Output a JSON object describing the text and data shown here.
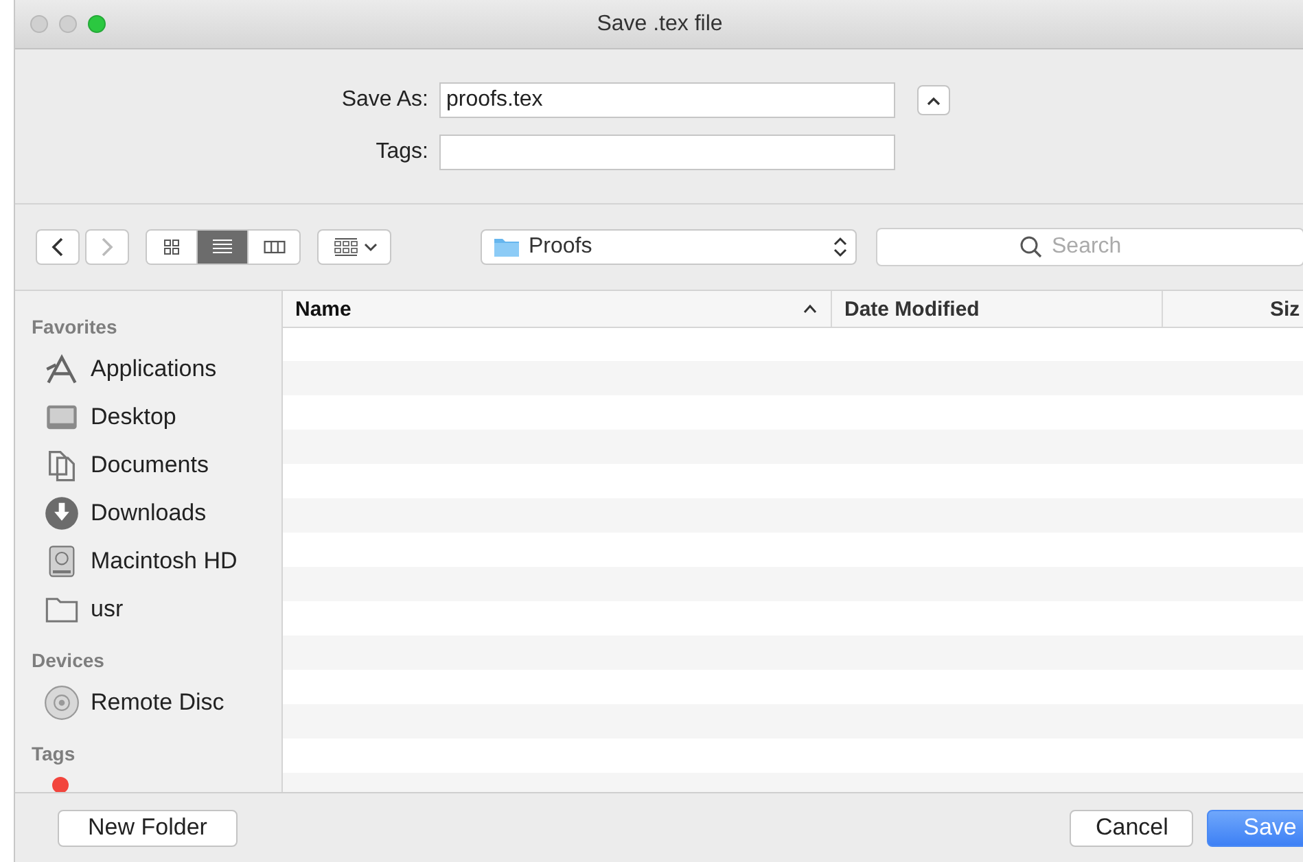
{
  "window": {
    "title": "Save .tex file"
  },
  "save_as": {
    "label": "Save As:",
    "value": "proofs.tex"
  },
  "tags_field": {
    "label": "Tags:"
  },
  "toolbar": {
    "back": {
      "disabled": false
    },
    "forward": {
      "disabled": true
    },
    "view_modes": [
      {
        "kind": "icons",
        "selected": false
      },
      {
        "kind": "list",
        "selected": true
      },
      {
        "kind": "columns",
        "selected": false
      }
    ],
    "location": "Proofs",
    "search": {
      "placeholder": "Search"
    }
  },
  "sidebar": {
    "sections": [
      {
        "title": "Favorites",
        "items": [
          {
            "kind": "apps",
            "label": "Applications"
          },
          {
            "kind": "desktop",
            "label": "Desktop"
          },
          {
            "kind": "documents",
            "label": "Documents"
          },
          {
            "kind": "downloads",
            "label": "Downloads"
          },
          {
            "kind": "disk",
            "label": "Macintosh HD"
          },
          {
            "kind": "folder",
            "label": "usr"
          }
        ]
      },
      {
        "title": "Devices",
        "items": [
          {
            "kind": "disc",
            "label": "Remote Disc"
          }
        ]
      },
      {
        "title": "Tags",
        "items": [
          {
            "kind": "tag",
            "color": "#f2453d"
          }
        ]
      }
    ]
  },
  "table": {
    "columns": [
      {
        "label": "Name",
        "sorted": true
      },
      {
        "label": "Date Modified",
        "sorted": false
      },
      {
        "label": "Siz",
        "sorted": false
      }
    ]
  },
  "buttons": {
    "new_folder": "New Folder",
    "cancel": "Cancel",
    "save": "Save"
  }
}
